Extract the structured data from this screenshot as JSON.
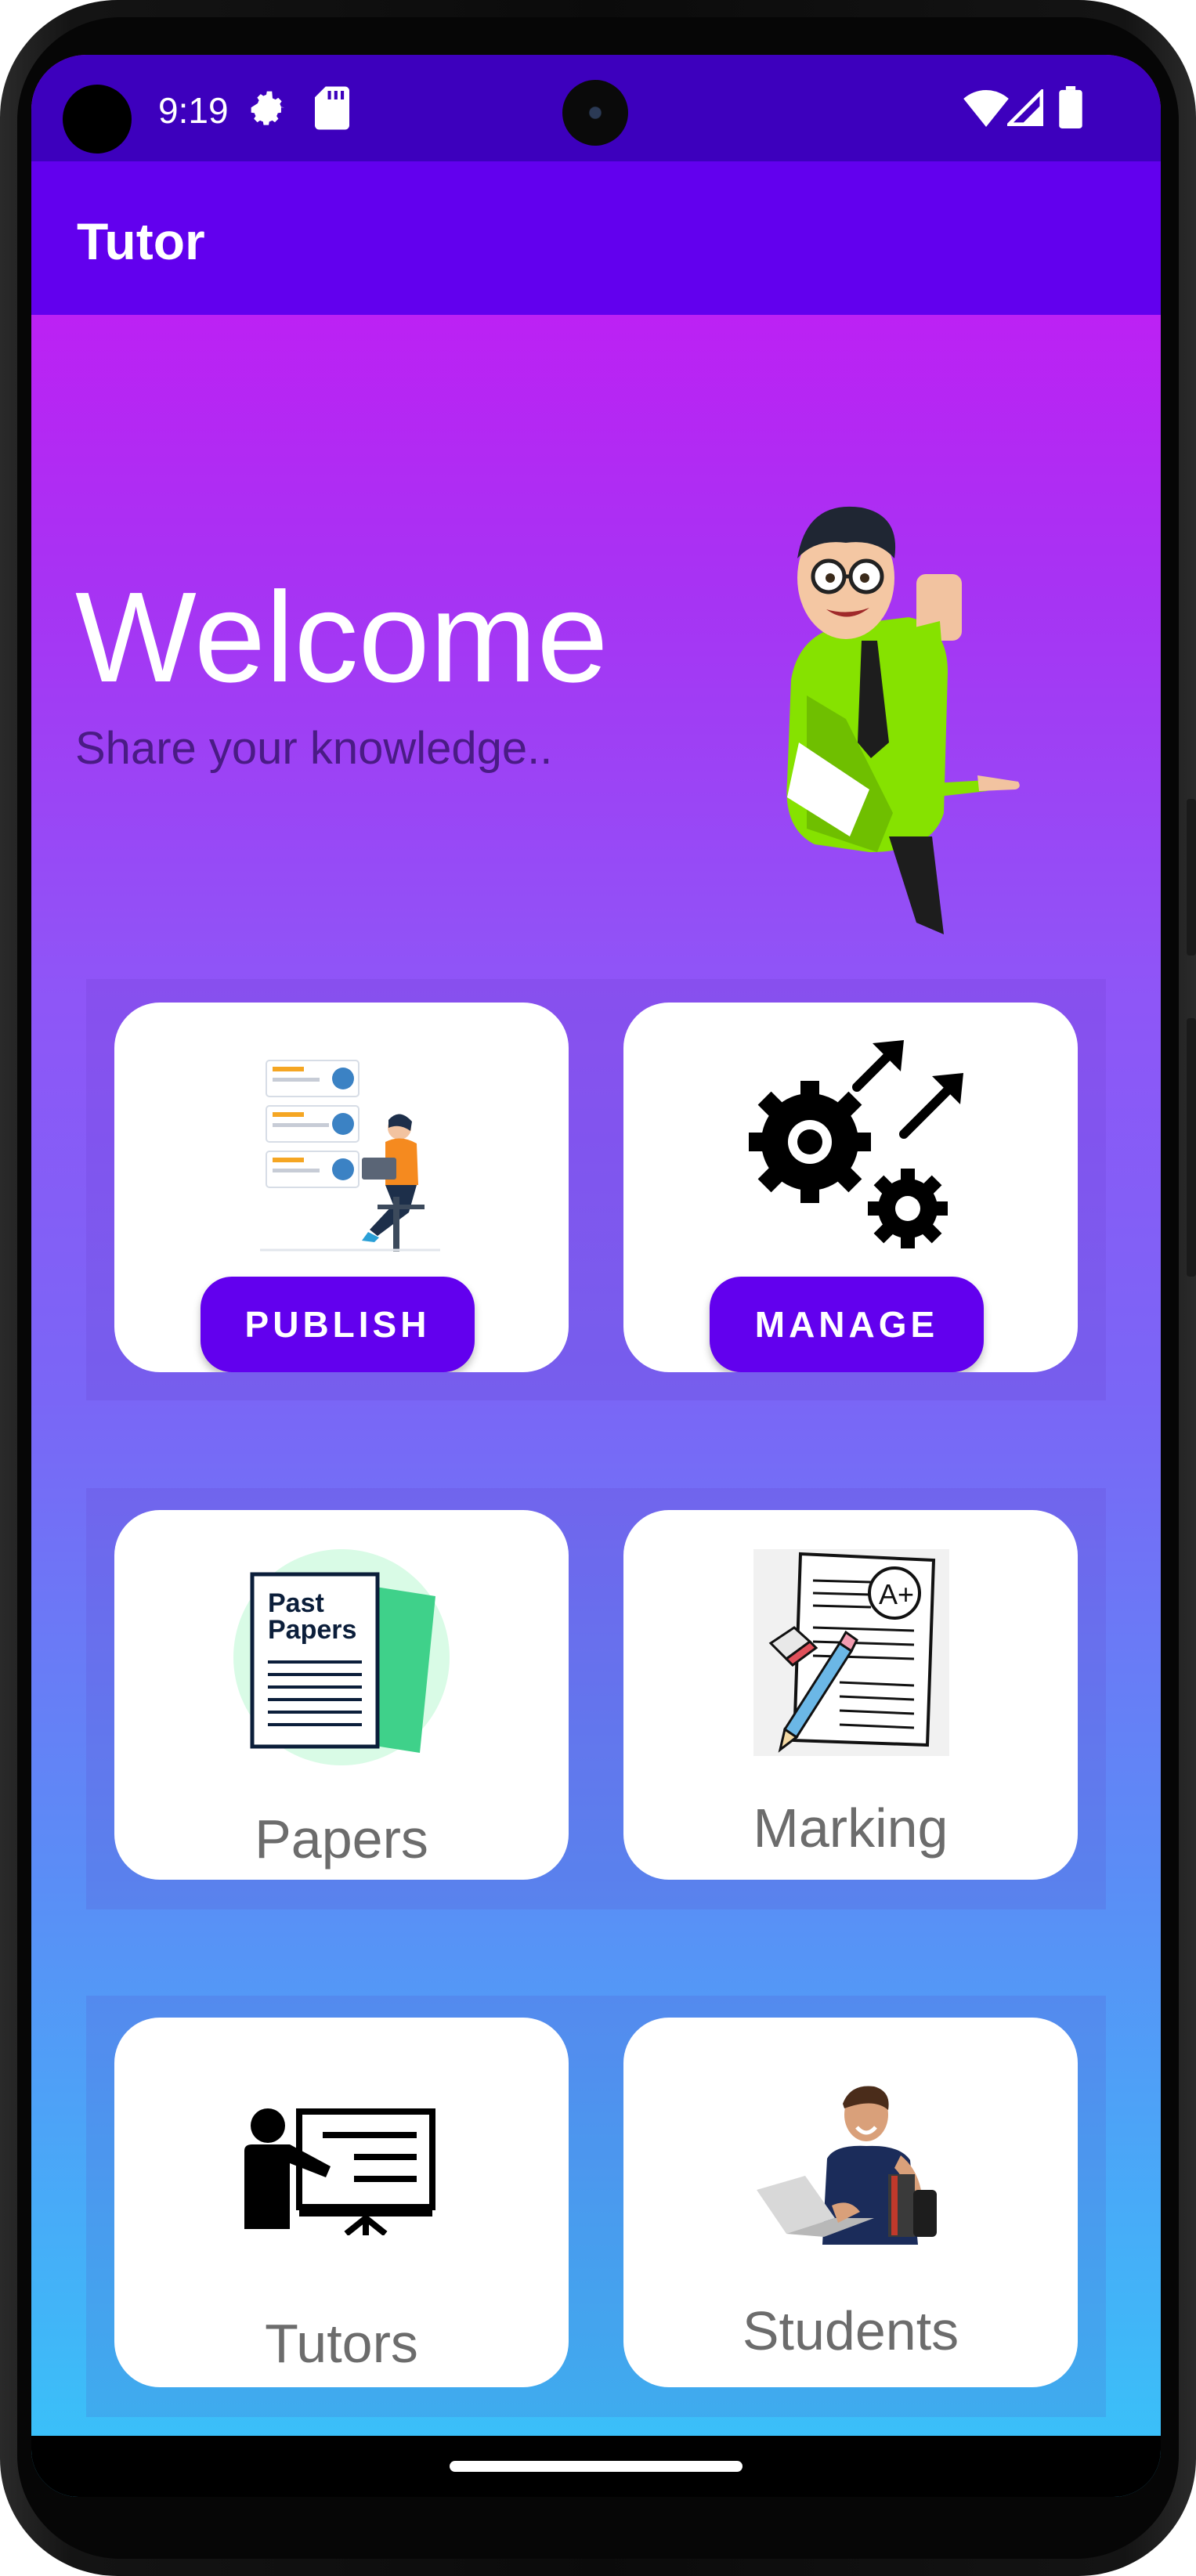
{
  "status_bar": {
    "time": "9:19"
  },
  "app_bar": {
    "title": "Tutor"
  },
  "hero": {
    "heading": "Welcome",
    "subtitle": "Share your knowledge.."
  },
  "cards": {
    "publish": {
      "button_label": "PUBLISH",
      "icon": "reviews-illustration"
    },
    "manage": {
      "button_label": "MANAGE",
      "icon": "gears-arrows-icon"
    },
    "papers": {
      "label": "Papers",
      "icon": "past-papers-icon",
      "icon_text_line1": "Past",
      "icon_text_line2": "Papers"
    },
    "marking": {
      "label": "Marking",
      "icon": "graded-paper-icon",
      "grade_text": "A+"
    },
    "tutors": {
      "label": "Tutors",
      "icon": "teacher-board-icon"
    },
    "students": {
      "label": "Students",
      "icon": "student-photo"
    }
  },
  "colors": {
    "status_bar": "#3d00bd",
    "app_bar": "#6200ee",
    "accent_button": "#6200ee",
    "gradient_top": "#d010f4",
    "gradient_bottom": "#37c5f9",
    "card_label": "#6c6c6c"
  }
}
